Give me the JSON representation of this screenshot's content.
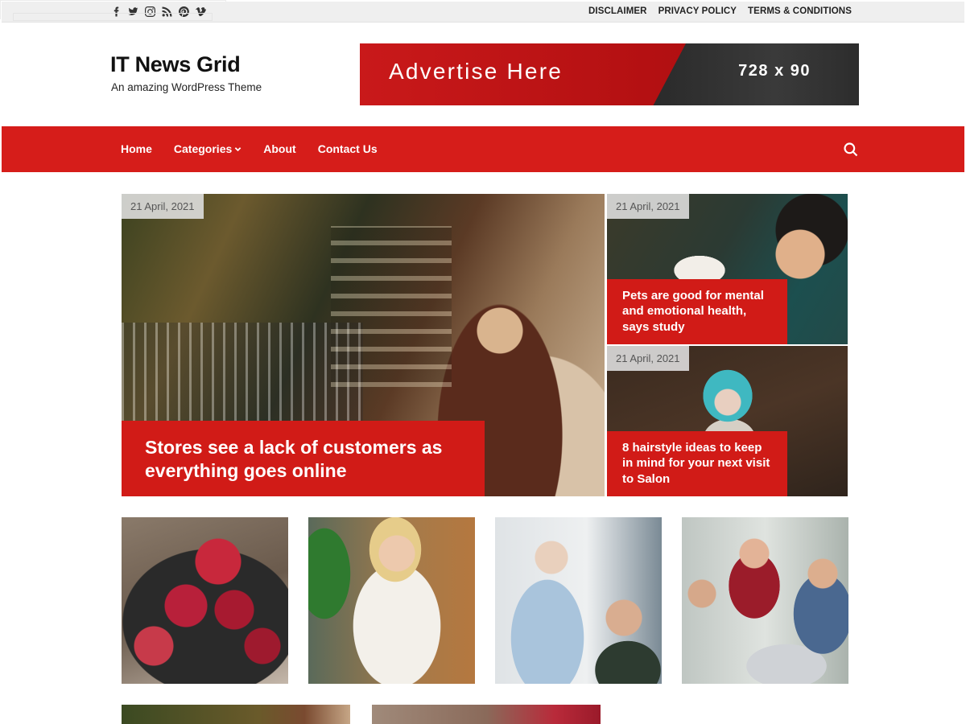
{
  "topbar": {
    "social_icons": [
      "facebook-icon",
      "twitter-icon",
      "instagram-icon",
      "rss-icon",
      "pinterest-icon",
      "vimeo-icon"
    ],
    "links": [
      "DISCLAIMER",
      "PRIVACY POLICY",
      "TERMS & CONDITIONS"
    ]
  },
  "header": {
    "site_title": "IT News Grid",
    "tagline": "An amazing WordPress Theme",
    "ad": {
      "text": "Advertise Here",
      "size": "728 x 90"
    }
  },
  "nav": {
    "items": [
      "Home",
      "Categories",
      "About",
      "Contact Us"
    ],
    "search_icon": "search-icon",
    "background": "#d61d1a"
  },
  "featured": {
    "main": {
      "date": "21 April, 2021",
      "title": "Stores see a lack of customers as everything goes online"
    },
    "side": [
      {
        "date": "21 April, 2021",
        "title": "Pets are good for mental and emotional health, says study"
      },
      {
        "date": "21 April, 2021",
        "title": "8 hairstyle ideas to keep in mind for your next visit to Salon"
      }
    ]
  },
  "colors": {
    "accent": "#d11b17",
    "topbar": "#efefef"
  }
}
